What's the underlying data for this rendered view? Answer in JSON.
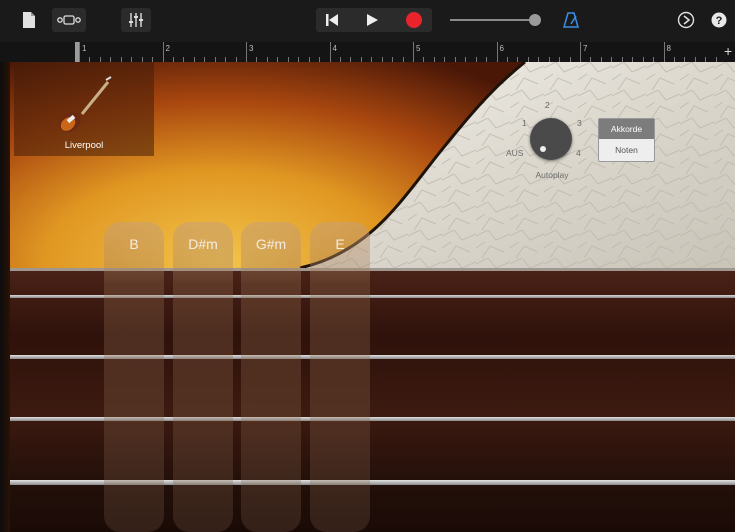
{
  "toolbar": {
    "icons": {
      "document": "document-icon",
      "loops": "tracks-view-icon",
      "mixer": "mixer-sliders-icon",
      "rewind": "rewind-icon",
      "play": "play-icon",
      "record": "record-icon",
      "metronome": "metronome-icon",
      "settings": "settings-icon",
      "help": "help-icon"
    },
    "volume_level": 0.97,
    "colors": {
      "record": "#e8232c",
      "metronome": "#3a8fe8"
    }
  },
  "ruler": {
    "bars": [
      "1",
      "2",
      "3",
      "4",
      "5",
      "6",
      "7",
      "8"
    ],
    "add_label": "+"
  },
  "instrument": {
    "name": "Liverpool",
    "icon": "bass-guitar-icon"
  },
  "autoplay": {
    "label": "Autoplay",
    "off_label": "AUS",
    "positions": [
      "1",
      "2",
      "3",
      "4"
    ]
  },
  "mode_toggle": {
    "options": [
      "Akkorde",
      "Noten"
    ],
    "selected": "Akkorde"
  },
  "chords": [
    "B",
    "D#m",
    "G#m",
    "E"
  ]
}
